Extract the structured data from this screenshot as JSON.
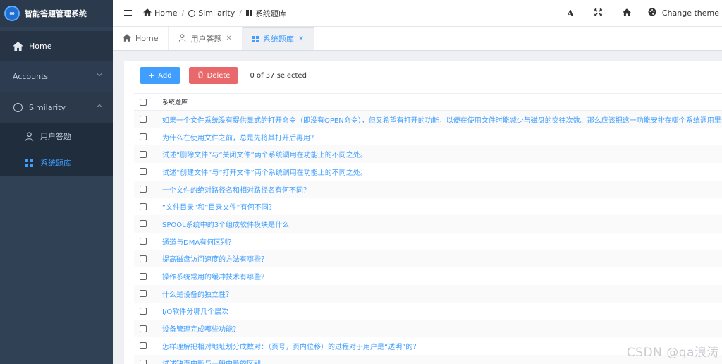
{
  "app": {
    "title": "智能答题管理系统",
    "logo": "∞"
  },
  "sidebar": {
    "items": [
      {
        "label": "Home",
        "icon": "home-icon"
      },
      {
        "label": "Accounts",
        "icon": ""
      },
      {
        "label": "Similarity",
        "icon": "circle-icon"
      }
    ],
    "subitems": [
      {
        "label": "用户答题",
        "icon": "user-icon"
      },
      {
        "label": "系统题库",
        "icon": "grid-icon"
      }
    ]
  },
  "navbar": {
    "breadcrumb": [
      "Home",
      "Similarity",
      "系统题库"
    ],
    "change_theme": "Change theme"
  },
  "tags": [
    {
      "label": "Home"
    },
    {
      "label": "用户答题"
    },
    {
      "label": "系统题库"
    }
  ],
  "toolbar": {
    "add_label": "Add",
    "delete_label": "Delete",
    "selected_text": "0 of 37 selected"
  },
  "table": {
    "header": "系统题库",
    "rows": [
      "如果一个文件系统没有提供显式的打开命令（即没有OPEN命令），但又希望有打开的功能，以便在使用文件时能减少与磁盘的交往次数。那么应该把这一功能安排在哪个系统调用里合适",
      "为什么在使用文件之前，总是先将其打开后再用？",
      "试述“删除文件”与“关闭文件”两个系统调用在功能上的不同之处。",
      "试述“创建文件”与“打开文件”两个系统调用在功能上的不同之处。",
      "一个文件的绝对路径名和相对路径名有何不同？",
      "“文件目录”和“目录文件”有何不同？",
      "SPOOL系统中的3个组成软件模块是什么",
      "通道与DMA有何区别？",
      "提高磁盘访问速度的方法有哪些？",
      "操作系统常用的缓冲技术有哪些？",
      "什么是设备的独立性？",
      "I/O软件分哪几个层次",
      "设备管理完成哪些功能？",
      "怎样理解把相对地址划分成数对：（页号，页内位移）的过程对于用户是“透明”的？",
      "试述缺页中断与一般中断的区别"
    ]
  },
  "watermark": "CSDN @qa浪涛",
  "colors": {
    "sidebar_bg": "#304156",
    "accent": "#409eff",
    "danger": "#e9686b"
  }
}
